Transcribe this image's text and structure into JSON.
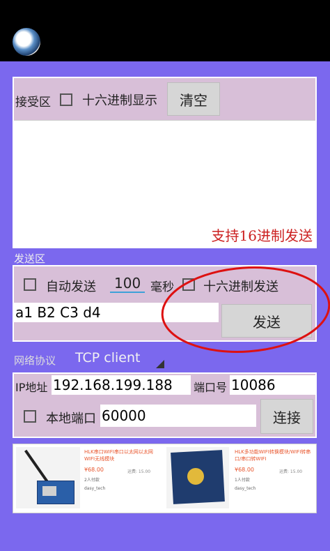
{
  "receive": {
    "label": "接受区",
    "hex_display_label": "十六进制显示",
    "hex_display_checked": false,
    "clear_button": "清空",
    "content": "",
    "hint": "支持16进制发送",
    "hint_color": "#cc2222"
  },
  "send": {
    "section_label": "发送区",
    "auto_send_label": "自动发送",
    "auto_send_checked": false,
    "interval_value": "100",
    "interval_unit": "毫秒",
    "hex_send_label": "十六进制发送",
    "hex_send_checked": false,
    "data": "a1 B2 C3 d4",
    "send_button": "发送"
  },
  "network": {
    "protocol_label": "网络协议",
    "protocol_value": "TCP client",
    "ip_label": "IP地址",
    "ip_value": "192.168.199.188",
    "port_label": "端口号",
    "port_value": "10086",
    "local_port_label": "本地端口",
    "local_port_checked": false,
    "local_port_value": "60000",
    "connect_button": "连接"
  },
  "ad": {
    "items": [
      {
        "title": "HLK串口WIFI串口以太网以太网WIFI无线模块",
        "price": "¥68.00",
        "sales": "2人付款",
        "shipping": "运费: 15.00",
        "seller": "dasy_tech"
      },
      {
        "title": "HLK多功能WIFI转换模块/WIFI转串口/串口转WIFI",
        "price": "¥68.00",
        "sales": "1人付款",
        "shipping": "运费: 15.00",
        "seller": "dasy_tech"
      }
    ],
    "accent": "#e8542b"
  },
  "colors": {
    "background": "#7b68ee",
    "panel": "#d8bfd8"
  }
}
